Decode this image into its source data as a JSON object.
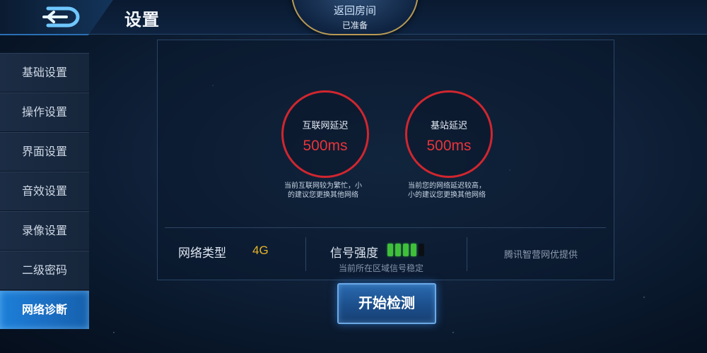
{
  "header": {
    "title": "设置",
    "room_button": {
      "label": "返回房间",
      "status": "已准备"
    }
  },
  "sidebar": {
    "items": [
      {
        "label": "基础设置",
        "active": false
      },
      {
        "label": "操作设置",
        "active": false
      },
      {
        "label": "界面设置",
        "active": false
      },
      {
        "label": "音效设置",
        "active": false
      },
      {
        "label": "录像设置",
        "active": false
      },
      {
        "label": "二级密码",
        "active": false
      },
      {
        "label": "网络诊断",
        "active": true
      }
    ]
  },
  "diagnostics": {
    "internet": {
      "label": "互联网延迟",
      "value": "500ms",
      "advice_line1": "当前互联网较为繁忙，小",
      "advice_line2": "的建议您更换其他网络"
    },
    "base_station": {
      "label": "基站延迟",
      "value": "500ms",
      "advice_line1": "当前您的网络延迟较高，",
      "advice_line2": "小的建议您更换其他网络"
    }
  },
  "network": {
    "type_label": "网络类型",
    "type_value": "4G",
    "signal_label": "信号强度",
    "signal_bars_filled": 4,
    "signal_bars_total": 5,
    "signal_note": "当前所在区域信号稳定",
    "provider": "腾讯智营网优提供"
  },
  "actions": {
    "start_label": "开始检测"
  },
  "colors": {
    "accent_blue": "#1d7fd8",
    "latency_red": "#d1262f",
    "signal_green": "#3fbf3a",
    "network_type_yellow": "#e7b429"
  }
}
